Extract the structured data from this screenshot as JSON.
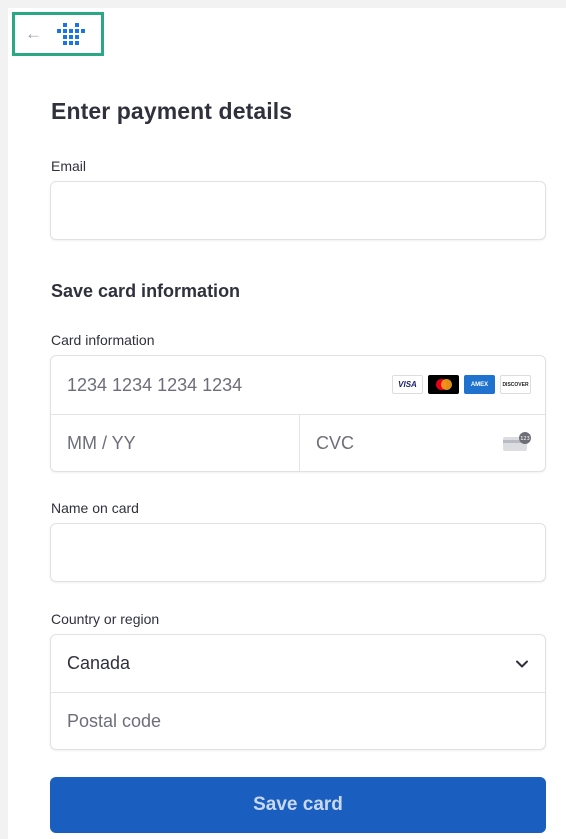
{
  "header": {
    "back_icon": "arrow-left-icon",
    "logo_icon": "grid-logo-icon"
  },
  "title": "Enter payment details",
  "email": {
    "label": "Email",
    "value": ""
  },
  "save_card_section": "Save card information",
  "card": {
    "label": "Card information",
    "number_placeholder": "1234 1234 1234 1234",
    "expiry_placeholder": "MM / YY",
    "cvc_placeholder": "CVC",
    "brands": [
      "VISA",
      "Mastercard",
      "American Express",
      "DISCOVER"
    ]
  },
  "name": {
    "label": "Name on card",
    "value": ""
  },
  "country": {
    "label": "Country or region",
    "selected": "Canada",
    "postal_placeholder": "Postal code"
  },
  "submit_label": "Save card",
  "colors": {
    "accent_button": "#1a5fbf",
    "highlight_border": "#2aa784"
  }
}
